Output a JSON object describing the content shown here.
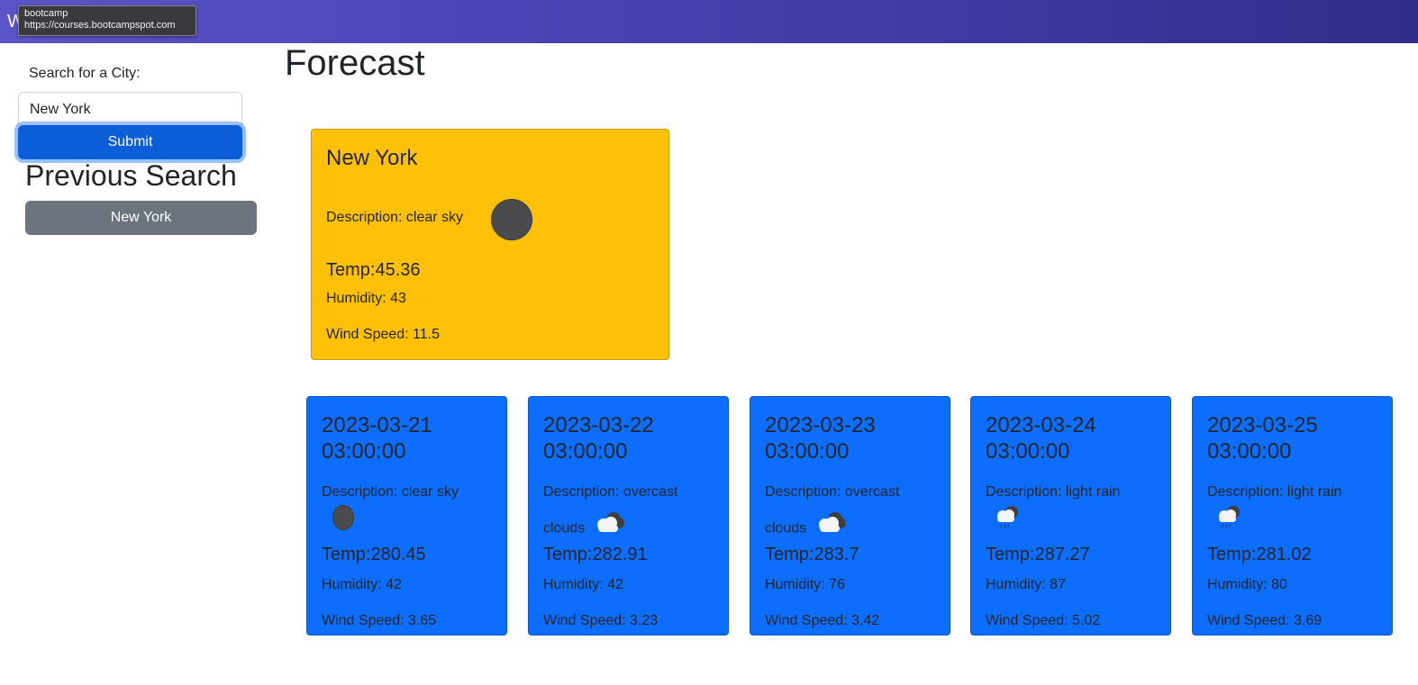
{
  "header": {
    "initial": "W",
    "tooltip_title": "bootcamp",
    "tooltip_url": "https://courses.bootcampspot.com"
  },
  "sidebar": {
    "search_label": "Search for a City:",
    "search_value": "New York",
    "submit_label": "Submit",
    "previous_title": "Previous Search",
    "history": [
      "New York"
    ]
  },
  "main": {
    "title": "Forecast",
    "current": {
      "city": "New York",
      "description": "Description: clear sky",
      "icon": "moon-icon",
      "temp": "Temp:45.36",
      "humidity": "Humidity: 43",
      "wind": "Wind Speed: 11.5",
      "color": "#ffc107"
    },
    "forecast": [
      {
        "date": "2023-03-21 03:00:00",
        "description": "Description: clear sky",
        "icon": "moon-icon",
        "temp": "Temp:280.45",
        "humidity": "Humidity: 42",
        "wind": "Wind Speed: 3.65"
      },
      {
        "date": "2023-03-22 03:00:00",
        "description": "Description: overcast clouds",
        "icon": "cloud-icon",
        "temp": "Temp:282.91",
        "humidity": "Humidity: 42",
        "wind": "Wind Speed: 3.23"
      },
      {
        "date": "2023-03-23 03:00:00",
        "description": "Description: overcast clouds",
        "icon": "cloud-icon",
        "temp": "Temp:283.7",
        "humidity": "Humidity: 76",
        "wind": "Wind Speed: 3.42"
      },
      {
        "date": "2023-03-24 03:00:00",
        "description": "Description: light rain",
        "icon": "rain-cloud-icon",
        "temp": "Temp:287.27",
        "humidity": "Humidity: 87",
        "wind": "Wind Speed: 5.02"
      },
      {
        "date": "2023-03-25 03:00:00",
        "description": "Description: light rain",
        "icon": "rain-cloud-icon",
        "temp": "Temp:281.02",
        "humidity": "Humidity: 80",
        "wind": "Wind Speed: 3.69"
      }
    ]
  },
  "colors": {
    "header_gradient_start": "#5b55c9",
    "header_gradient_end": "#2f2e88",
    "submit": "#0b5ed7",
    "history_button": "#6c757d",
    "forecast_card": "#0d6efd"
  }
}
